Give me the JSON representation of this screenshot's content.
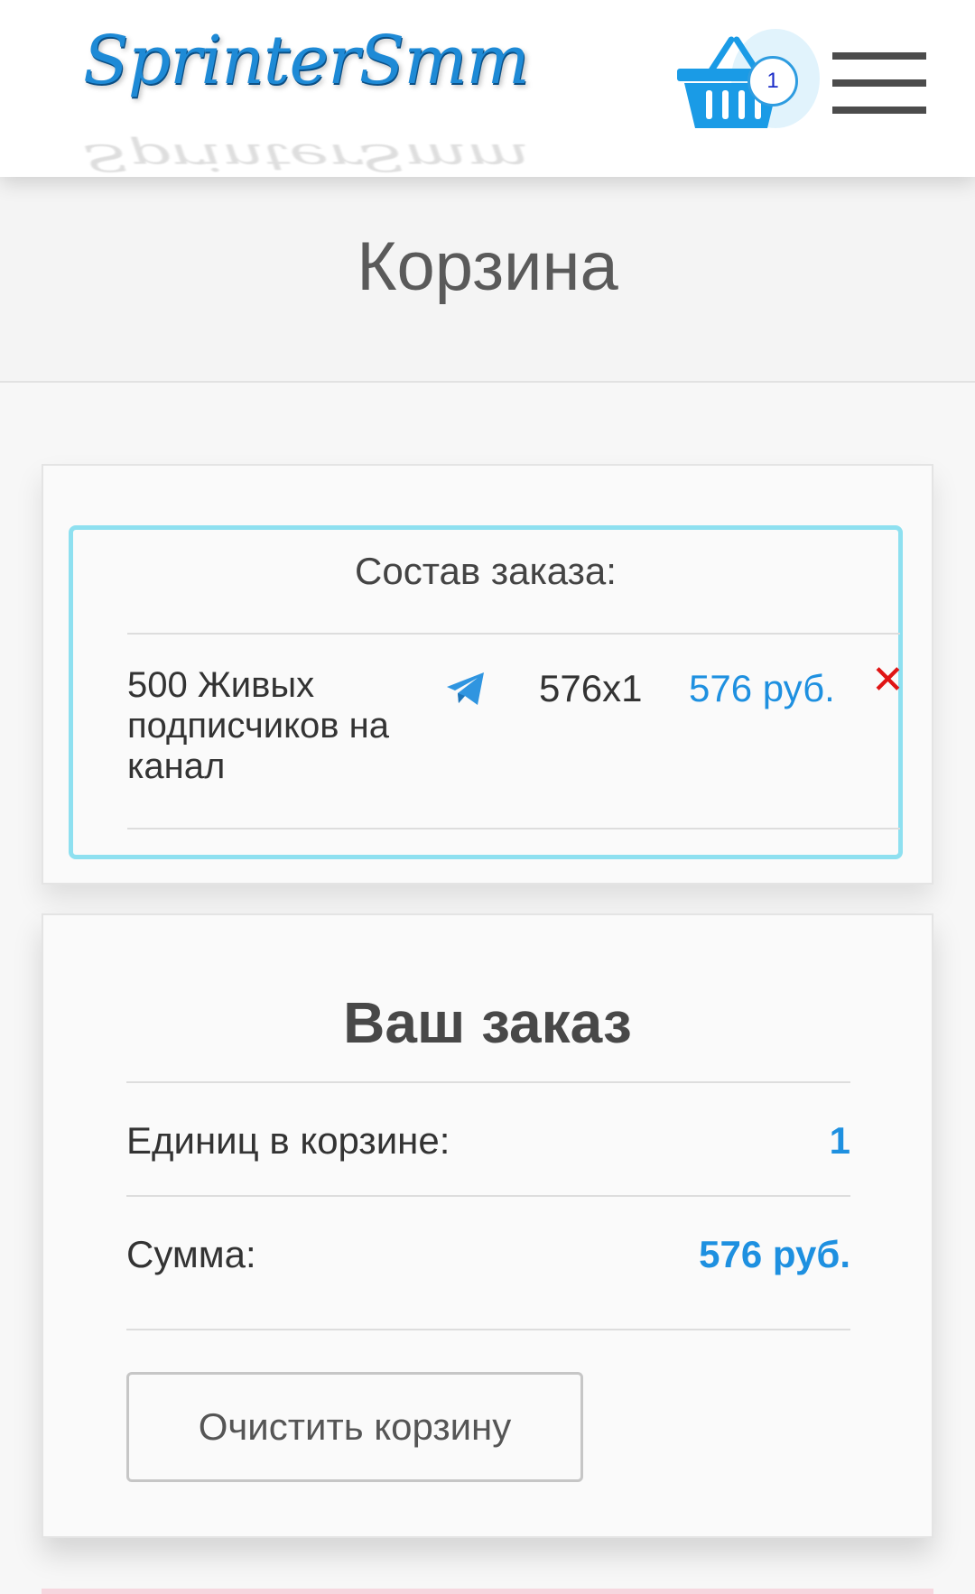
{
  "header": {
    "logo_text": "SprinterSmm",
    "cart_count": "1",
    "cart_icon": "shopping-basket-icon",
    "menu_icon": "hamburger-menu-icon"
  },
  "page": {
    "title": "Корзина"
  },
  "order": {
    "composition_title": "Состав заказа:",
    "items": [
      {
        "name": "500 Живых подписчиков на канал",
        "platform_icon": "telegram-icon",
        "quantity": "576x1",
        "price": "576 руб.",
        "remove_symbol": "✕"
      }
    ]
  },
  "summary": {
    "title": "Ваш заказ",
    "units_label": "Единиц в корзине:",
    "units_value": "1",
    "sum_label": "Сумма:",
    "sum_value": "576 руб.",
    "clear_button": "Очистить корзину"
  },
  "colors": {
    "accent_blue": "#1e90e0",
    "logo_blue": "#1e8ad6",
    "box_border": "#8ee0f0",
    "remove_red": "#e01515"
  }
}
